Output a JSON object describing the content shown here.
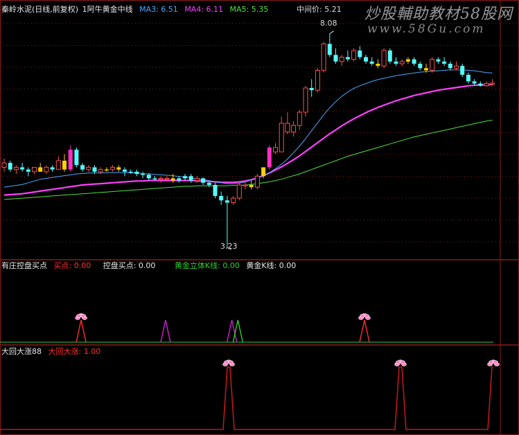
{
  "watermark": {
    "line1": "炒股輔助教材58股网",
    "line2": "www.58Gu.com"
  },
  "main_panel": {
    "stock_label": "秦岭水泥(日线,前复权)",
    "indicator": "1阿牛黄金中线",
    "ma3_label": "MA3: 6.51",
    "ma4_label": "MA4: 6.11",
    "ma5_label": "MA5: 5.35",
    "mid_price": "中间价: 5.21",
    "high_label": "8.08",
    "low_label": "3.23"
  },
  "sub_panel1": {
    "label1": "有庄控盘买点",
    "label2": "买点: 0.00",
    "label3": "控盘买点: 0.00",
    "label4": "黄金立体K线: 0.00",
    "label5": "黄金K线: 0.00"
  },
  "sub_panel2": {
    "label1": "大回大涨88",
    "label2": "大回大涨: 1.00"
  },
  "colors": {
    "up": "#ff5050",
    "down": "#54ffff",
    "yellow": "#ffd000",
    "magenta_bar": "#ff30c0",
    "ma3": "#4aa8ff",
    "ma4": "#ff40ff",
    "ma5": "#50e040",
    "grid": "#8b1a1a",
    "signal_red": "#ff3030",
    "signal_magenta": "#d020d0",
    "signal_green": "#30d030",
    "flower": "#ff80c0"
  },
  "chart_data": {
    "type": "candlestick",
    "x_count": 82,
    "yrange": [
      3.0,
      8.5
    ],
    "candles": [
      [
        5.05,
        5.25,
        4.95,
        5.15,
        "up"
      ],
      [
        5.15,
        5.2,
        4.95,
        5.0,
        "down"
      ],
      [
        5.0,
        5.1,
        4.9,
        5.05,
        "up"
      ],
      [
        5.05,
        5.15,
        4.95,
        5.0,
        "down"
      ],
      [
        5.0,
        5.05,
        4.85,
        4.95,
        "down"
      ],
      [
        4.95,
        5.05,
        4.9,
        5.05,
        "up"
      ],
      [
        5.05,
        5.15,
        4.95,
        4.95,
        "yellow"
      ],
      [
        4.95,
        5.1,
        4.9,
        5.05,
        "up"
      ],
      [
        5.05,
        5.1,
        4.95,
        5.0,
        "down"
      ],
      [
        5.0,
        5.3,
        5.0,
        5.2,
        "up"
      ],
      [
        5.2,
        5.35,
        4.95,
        5.0,
        "yellow"
      ],
      [
        5.0,
        5.55,
        4.95,
        5.45,
        "magenta"
      ],
      [
        5.45,
        5.5,
        5.05,
        5.1,
        "down"
      ],
      [
        5.1,
        5.15,
        4.95,
        5.0,
        "down"
      ],
      [
        5.0,
        5.1,
        4.95,
        5.05,
        "up"
      ],
      [
        5.05,
        5.1,
        4.9,
        4.95,
        "down"
      ],
      [
        4.95,
        5.05,
        4.9,
        5.0,
        "up"
      ],
      [
        5.0,
        5.05,
        4.95,
        5.0,
        "yellow"
      ],
      [
        5.0,
        5.1,
        4.95,
        5.05,
        "up"
      ],
      [
        5.05,
        5.1,
        4.95,
        5.0,
        "yellow"
      ],
      [
        5.0,
        5.05,
        4.85,
        4.95,
        "down"
      ],
      [
        4.95,
        5.0,
        4.9,
        4.95,
        "down"
      ],
      [
        4.95,
        5.0,
        4.85,
        4.9,
        "down"
      ],
      [
        4.9,
        4.95,
        4.8,
        4.88,
        "down"
      ],
      [
        4.88,
        4.92,
        4.75,
        4.8,
        "down"
      ],
      [
        4.8,
        4.85,
        4.75,
        4.8,
        "down"
      ],
      [
        4.8,
        4.85,
        4.7,
        4.78,
        "up"
      ],
      [
        4.78,
        4.85,
        4.75,
        4.8,
        "up"
      ],
      [
        4.8,
        4.9,
        4.7,
        4.75,
        "yellow"
      ],
      [
        4.75,
        4.85,
        4.7,
        4.8,
        "down"
      ],
      [
        4.8,
        4.9,
        4.75,
        4.85,
        "down"
      ],
      [
        4.85,
        4.9,
        4.7,
        4.75,
        "down"
      ],
      [
        4.75,
        4.85,
        4.7,
        4.8,
        "up"
      ],
      [
        4.8,
        4.82,
        4.65,
        4.7,
        "down"
      ],
      [
        4.7,
        4.72,
        4.6,
        4.65,
        "down"
      ],
      [
        4.65,
        4.7,
        4.35,
        4.4,
        "down"
      ],
      [
        4.4,
        4.5,
        4.2,
        4.3,
        "down"
      ],
      [
        4.3,
        4.4,
        3.23,
        4.25,
        "down"
      ],
      [
        4.25,
        4.4,
        4.2,
        4.35,
        "up"
      ],
      [
        4.35,
        4.7,
        4.3,
        4.65,
        "up"
      ],
      [
        4.65,
        4.75,
        4.55,
        4.65,
        "up"
      ],
      [
        4.65,
        4.75,
        4.55,
        4.6,
        "yellow"
      ],
      [
        4.6,
        4.9,
        4.55,
        4.85,
        "up"
      ],
      [
        4.85,
        5.05,
        4.8,
        5.05,
        "yellow"
      ],
      [
        5.05,
        5.55,
        5.0,
        5.5,
        "magenta"
      ],
      [
        5.5,
        5.6,
        5.35,
        5.4,
        "up"
      ],
      [
        5.4,
        6.2,
        5.4,
        6.05,
        "up"
      ],
      [
        6.05,
        6.3,
        5.8,
        5.85,
        "up"
      ],
      [
        5.85,
        6.1,
        5.75,
        6.0,
        "up"
      ],
      [
        6.0,
        6.35,
        5.9,
        6.3,
        "up"
      ],
      [
        6.3,
        6.9,
        6.2,
        6.85,
        "up"
      ],
      [
        6.85,
        7.05,
        6.65,
        6.8,
        "down"
      ],
      [
        6.8,
        7.3,
        6.75,
        7.25,
        "up"
      ],
      [
        7.25,
        7.9,
        7.2,
        7.85,
        "up"
      ],
      [
        7.85,
        8.08,
        7.55,
        7.6,
        "down"
      ],
      [
        7.6,
        7.75,
        7.4,
        7.45,
        "down"
      ],
      [
        7.45,
        7.6,
        7.35,
        7.55,
        "up"
      ],
      [
        7.55,
        7.7,
        7.45,
        7.5,
        "down"
      ],
      [
        7.5,
        7.75,
        7.45,
        7.7,
        "up"
      ],
      [
        7.7,
        7.8,
        7.5,
        7.55,
        "down"
      ],
      [
        7.55,
        7.6,
        7.4,
        7.45,
        "down"
      ],
      [
        7.45,
        7.55,
        7.35,
        7.4,
        "down"
      ],
      [
        7.4,
        7.5,
        7.3,
        7.35,
        "yellow"
      ],
      [
        7.35,
        7.75,
        7.3,
        7.7,
        "up"
      ],
      [
        7.7,
        7.75,
        7.4,
        7.45,
        "down"
      ],
      [
        7.45,
        7.55,
        7.35,
        7.4,
        "down"
      ],
      [
        7.4,
        7.5,
        7.35,
        7.45,
        "up"
      ],
      [
        7.45,
        7.55,
        7.4,
        7.5,
        "yellow"
      ],
      [
        7.5,
        7.55,
        7.35,
        7.4,
        "down"
      ],
      [
        7.4,
        7.45,
        7.25,
        7.3,
        "down"
      ],
      [
        7.3,
        7.4,
        7.2,
        7.25,
        "yellow"
      ],
      [
        7.25,
        7.55,
        7.2,
        7.5,
        "up"
      ],
      [
        7.5,
        7.55,
        7.4,
        7.45,
        "down"
      ],
      [
        7.45,
        7.55,
        7.35,
        7.4,
        "down"
      ],
      [
        7.4,
        7.45,
        7.25,
        7.3,
        "down"
      ],
      [
        7.3,
        7.45,
        7.25,
        7.35,
        "up"
      ],
      [
        7.35,
        7.4,
        7.1,
        7.15,
        "down"
      ],
      [
        7.15,
        7.2,
        6.95,
        7.0,
        "down"
      ],
      [
        7.0,
        7.05,
        6.9,
        6.95,
        "down"
      ],
      [
        6.95,
        7.0,
        6.88,
        6.9,
        "down"
      ],
      [
        6.9,
        7.0,
        6.88,
        6.95,
        "up"
      ],
      [
        6.95,
        7.05,
        6.9,
        6.96,
        "up"
      ]
    ],
    "ma3": [
      4.6,
      4.62,
      4.64,
      4.66,
      4.7,
      4.74,
      4.78,
      4.8,
      4.82,
      4.84,
      4.86,
      4.88,
      4.9,
      4.91,
      4.92,
      4.92,
      4.92,
      4.93,
      4.93,
      4.93,
      4.93,
      4.93,
      4.92,
      4.91,
      4.9,
      4.89,
      4.88,
      4.87,
      4.86,
      4.84,
      4.83,
      4.81,
      4.79,
      4.77,
      4.75,
      4.72,
      4.7,
      4.68,
      4.68,
      4.69,
      4.72,
      4.76,
      4.8,
      4.86,
      4.93,
      5.02,
      5.12,
      5.24,
      5.38,
      5.53,
      5.7,
      5.88,
      6.06,
      6.24,
      6.4,
      6.54,
      6.66,
      6.76,
      6.84,
      6.9,
      6.95,
      7.0,
      7.04,
      7.07,
      7.1,
      7.13,
      7.15,
      7.17,
      7.19,
      7.21,
      7.22,
      7.23,
      7.24,
      7.25,
      7.26,
      7.26,
      7.26,
      7.25,
      7.24,
      7.22,
      7.2,
      7.19
    ],
    "ma4": [
      4.42,
      4.43,
      4.44,
      4.45,
      4.47,
      4.49,
      4.51,
      4.53,
      4.55,
      4.57,
      4.59,
      4.61,
      4.63,
      4.65,
      4.66,
      4.67,
      4.68,
      4.69,
      4.7,
      4.71,
      4.72,
      4.73,
      4.74,
      4.74,
      4.75,
      4.75,
      4.75,
      4.75,
      4.75,
      4.75,
      4.75,
      4.75,
      4.74,
      4.74,
      4.73,
      4.72,
      4.71,
      4.71,
      4.71,
      4.72,
      4.74,
      4.77,
      4.81,
      4.86,
      4.92,
      4.99,
      5.06,
      5.14,
      5.22,
      5.31,
      5.41,
      5.51,
      5.61,
      5.71,
      5.81,
      5.9,
      5.99,
      6.07,
      6.15,
      6.22,
      6.29,
      6.35,
      6.41,
      6.46,
      6.51,
      6.56,
      6.6,
      6.64,
      6.68,
      6.71,
      6.74,
      6.77,
      6.8,
      6.82,
      6.84,
      6.86,
      6.88,
      6.9,
      6.91,
      6.92,
      6.92,
      6.93
    ],
    "ma5": [
      4.32,
      4.33,
      4.34,
      4.35,
      4.36,
      4.37,
      4.38,
      4.39,
      4.4,
      4.41,
      4.42,
      4.43,
      4.44,
      4.45,
      4.46,
      4.47,
      4.48,
      4.49,
      4.5,
      4.51,
      4.52,
      4.53,
      4.54,
      4.55,
      4.56,
      4.57,
      4.58,
      4.59,
      4.6,
      4.61,
      4.62,
      4.62,
      4.63,
      4.63,
      4.63,
      4.63,
      4.63,
      4.63,
      4.64,
      4.64,
      4.65,
      4.66,
      4.68,
      4.7,
      4.72,
      4.75,
      4.78,
      4.82,
      4.86,
      4.9,
      4.95,
      5.0,
      5.05,
      5.1,
      5.15,
      5.2,
      5.25,
      5.3,
      5.34,
      5.38,
      5.42,
      5.46,
      5.5,
      5.54,
      5.58,
      5.62,
      5.66,
      5.7,
      5.74,
      5.77,
      5.8,
      5.83,
      5.86,
      5.89,
      5.92,
      5.95,
      5.98,
      6.01,
      6.04,
      6.07,
      6.1,
      6.12
    ],
    "signals1": [
      {
        "i": 13,
        "color": "red",
        "flower": true
      },
      {
        "i": 27,
        "color": "magenta",
        "flower": false
      },
      {
        "i": 38,
        "color": "magenta",
        "flower": false
      },
      {
        "i": 39,
        "color": "green",
        "flower": false
      },
      {
        "i": 60,
        "color": "red",
        "flower": true
      }
    ],
    "signals2": [
      {
        "i": 37,
        "flower": true
      },
      {
        "i": 66,
        "flower": true
      },
      {
        "i": 81,
        "flower": true
      }
    ]
  }
}
